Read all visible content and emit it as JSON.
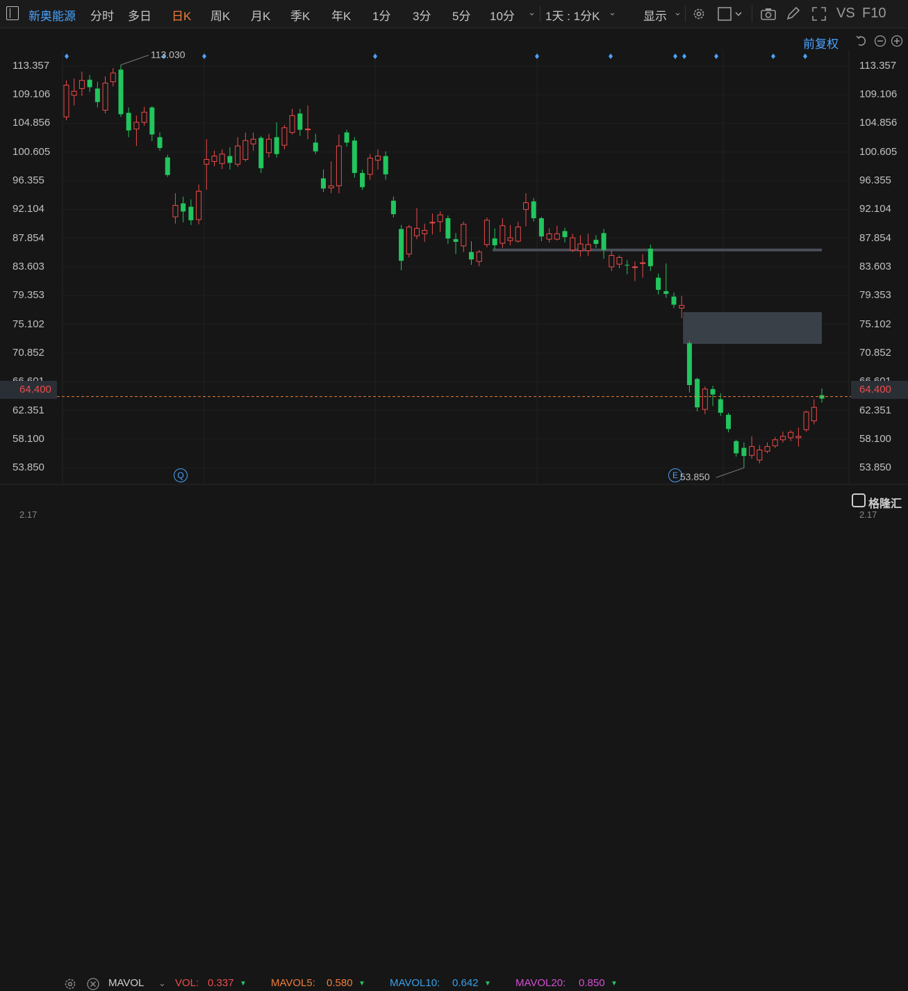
{
  "toolbar": {
    "stock_name": "新奥能源",
    "tabs": [
      "分时",
      "多日",
      "日K",
      "周K",
      "月K",
      "季K",
      "年K",
      "1分",
      "3分",
      "5分",
      "10分"
    ],
    "active_tab": "日K",
    "period_select": "1天 : 1分K",
    "display_label": "显示",
    "vs_label": "VS",
    "f10_label": "F10"
  },
  "header_right": {
    "adjust_label": "前复权"
  },
  "axis": {
    "y_labels": [
      "113.357",
      "109.106",
      "104.856",
      "100.605",
      "96.355",
      "92.104",
      "87.854",
      "83.603",
      "79.353",
      "75.102",
      "70.852",
      "66.601",
      "62.351",
      "58.100",
      "53.850"
    ],
    "current_price": "64.400"
  },
  "annotations": {
    "high_label": "113.030",
    "low_label": "53.850",
    "q_marker": "Q",
    "e_marker": "E"
  },
  "volume_bar": {
    "indicator": "MAVOL",
    "vol_label": "VOL:",
    "vol_value": "0.337",
    "mavol5_label": "MAVOL5:",
    "mavol5_value": "0.580",
    "mavol10_label": "MAVOL10:",
    "mavol10_value": "0.642",
    "mavol20_label": "MAVOL20:",
    "mavol20_value": "0.850",
    "bottom_left_value": "2.17",
    "bottom_right_value": "2.17"
  },
  "watermark": "格隆汇",
  "colors": {
    "up": "#ef4b4b",
    "down": "#22c55e",
    "accent": "#4aa3ff",
    "active_tab": "#f07d3a"
  },
  "chart_data": {
    "type": "candlestick",
    "ylim": [
      51.5,
      115.7
    ],
    "current_price": 64.4,
    "high": 113.03,
    "low": 53.85,
    "candles": [
      [
        105.8,
        110.5,
        111.2,
        105.3
      ],
      [
        109.0,
        109.6,
        111.5,
        107.5
      ],
      [
        110.0,
        111.2,
        112.5,
        108.9
      ],
      [
        111.3,
        110.2,
        112.0,
        109.5
      ],
      [
        110.0,
        108.0,
        111.0,
        107.2
      ],
      [
        106.8,
        110.8,
        111.8,
        106.3
      ],
      [
        111.0,
        112.3,
        113.03,
        110.3
      ],
      [
        112.8,
        106.2,
        113.5,
        105.8
      ],
      [
        106.4,
        103.8,
        107.2,
        102.8
      ],
      [
        104.0,
        105.0,
        106.0,
        101.5
      ],
      [
        105.0,
        106.5,
        107.3,
        104.5
      ],
      [
        107.2,
        103.2,
        107.4,
        102.2
      ],
      [
        102.8,
        101.2,
        103.5,
        100.8
      ],
      [
        99.8,
        97.2,
        100.2,
        96.9
      ],
      [
        91.0,
        92.7,
        94.5,
        90.0
      ],
      [
        93.0,
        91.8,
        94.0,
        90.2
      ],
      [
        92.5,
        90.5,
        93.6,
        89.8
      ],
      [
        90.6,
        94.8,
        95.8,
        89.9
      ],
      [
        98.8,
        99.5,
        102.5,
        95.0
      ],
      [
        99.2,
        100.0,
        100.8,
        98.5
      ],
      [
        98.9,
        100.3,
        101.0,
        98.1
      ],
      [
        100.0,
        99.0,
        101.3,
        98.0
      ],
      [
        98.8,
        101.5,
        102.8,
        98.4
      ],
      [
        99.5,
        102.3,
        103.5,
        99.2
      ],
      [
        101.8,
        102.5,
        103.5,
        100.8
      ],
      [
        102.7,
        98.2,
        103.0,
        97.5
      ],
      [
        100.5,
        102.5,
        103.3,
        99.8
      ],
      [
        102.8,
        100.3,
        105.0,
        99.8
      ],
      [
        101.6,
        104.2,
        104.6,
        101.0
      ],
      [
        103.5,
        106.0,
        107.0,
        103.2
      ],
      [
        106.3,
        103.9,
        107.0,
        103.0
      ],
      [
        104.0,
        104.0,
        107.5,
        102.5
      ],
      [
        102.0,
        100.7,
        103.3,
        100.3
      ],
      [
        96.7,
        95.2,
        98.0,
        94.7
      ],
      [
        95.3,
        95.6,
        99.2,
        94.5
      ],
      [
        95.6,
        101.5,
        103.2,
        94.5
      ],
      [
        103.5,
        102.0,
        103.9,
        101.4
      ],
      [
        102.3,
        97.5,
        102.8,
        96.8
      ],
      [
        97.5,
        95.4,
        98.0,
        95.0
      ],
      [
        97.3,
        99.7,
        100.3,
        96.5
      ],
      [
        99.4,
        100.0,
        101.0,
        98.0
      ],
      [
        100.0,
        97.3,
        100.7,
        96.5
      ],
      [
        93.4,
        91.4,
        94.0,
        90.9
      ],
      [
        89.2,
        84.5,
        89.8,
        83.1
      ],
      [
        85.5,
        89.5,
        89.8,
        85.0
      ],
      [
        88.2,
        89.3,
        92.3,
        87.7
      ],
      [
        88.5,
        89.0,
        90.0,
        87.3
      ],
      [
        90.2,
        90.2,
        91.5,
        88.4
      ],
      [
        90.3,
        91.3,
        91.8,
        88.8
      ],
      [
        90.8,
        87.8,
        91.2,
        87.0
      ],
      [
        87.7,
        87.3,
        88.6,
        85.5
      ],
      [
        86.7,
        89.9,
        90.3,
        85.8
      ],
      [
        85.8,
        84.7,
        87.4,
        83.9
      ],
      [
        84.4,
        85.8,
        86.1,
        83.7
      ],
      [
        86.9,
        90.5,
        90.9,
        86.5
      ],
      [
        87.8,
        86.8,
        89.3,
        86.2
      ],
      [
        87.1,
        89.7,
        90.8,
        86.4
      ],
      [
        87.5,
        87.9,
        89.8,
        86.8
      ],
      [
        87.4,
        89.5,
        90.3,
        87.2
      ],
      [
        92.1,
        93.1,
        94.5,
        89.6
      ],
      [
        93.3,
        90.8,
        93.8,
        90.3
      ],
      [
        90.8,
        88.1,
        91.0,
        87.4
      ],
      [
        87.7,
        88.5,
        89.3,
        87.2
      ],
      [
        87.7,
        88.5,
        89.7,
        87.5
      ],
      [
        88.9,
        88.0,
        89.4,
        87.2
      ],
      [
        86.1,
        87.9,
        88.5,
        85.8
      ],
      [
        86.0,
        87.0,
        88.3,
        85.1
      ],
      [
        86.0,
        86.9,
        88.5,
        85.2
      ],
      [
        87.6,
        87.0,
        88.3,
        86.4
      ],
      [
        88.6,
        86.1,
        89.2,
        84.8
      ],
      [
        83.6,
        85.3,
        86.0,
        83.0
      ],
      [
        84.0,
        85.0,
        85.3,
        83.4
      ],
      [
        83.9,
        83.8,
        84.6,
        82.5
      ],
      [
        83.5,
        83.6,
        84.4,
        81.5
      ],
      [
        84.2,
        84.2,
        85.5,
        82.0
      ],
      [
        86.3,
        83.7,
        86.9,
        83.0
      ],
      [
        82.0,
        80.2,
        82.6,
        79.5
      ],
      [
        80.0,
        79.6,
        84.1,
        79.0
      ],
      [
        79.2,
        78.0,
        79.8,
        77.5
      ],
      [
        77.5,
        77.9,
        79.3,
        76.0
      ],
      [
        72.3,
        66.1,
        72.6,
        65.0
      ],
      [
        67.0,
        62.8,
        67.2,
        62.2
      ],
      [
        62.5,
        65.5,
        65.9,
        61.8
      ],
      [
        65.5,
        64.7,
        66.0,
        63.0
      ],
      [
        64.0,
        62.0,
        64.9,
        61.5
      ],
      [
        61.7,
        59.6,
        62.0,
        59.1
      ],
      [
        57.8,
        56.0,
        58.0,
        55.5
      ],
      [
        56.8,
        55.6,
        57.6,
        53.85
      ],
      [
        55.7,
        57.0,
        58.5,
        55.2
      ],
      [
        55.0,
        56.5,
        57.2,
        54.5
      ],
      [
        56.3,
        57.0,
        57.6,
        56.0
      ],
      [
        57.1,
        58.0,
        58.4,
        56.8
      ],
      [
        58.0,
        58.5,
        59.2,
        57.6
      ],
      [
        58.3,
        59.1,
        59.4,
        57.8
      ],
      [
        58.3,
        58.5,
        59.8,
        57.0
      ],
      [
        59.5,
        62.1,
        62.3,
        59.2
      ],
      [
        60.8,
        62.8,
        64.0,
        60.3
      ],
      [
        64.6,
        64.1,
        65.6,
        63.5
      ]
    ]
  }
}
